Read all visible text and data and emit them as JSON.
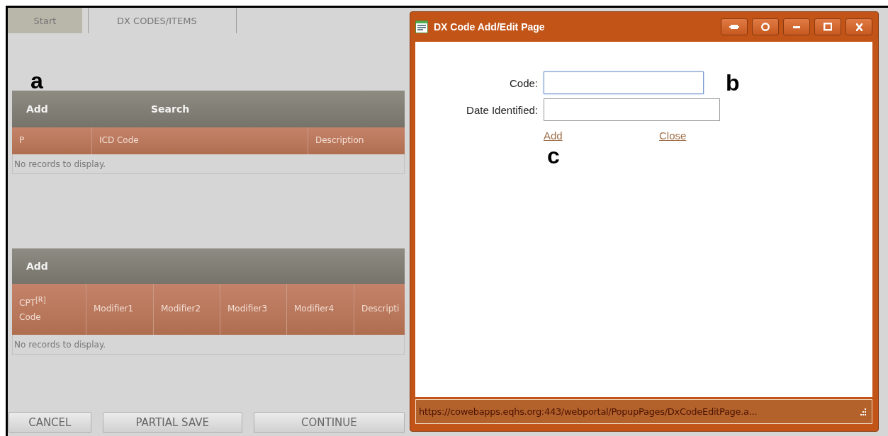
{
  "tabs": [
    {
      "label": "Start",
      "selected": false
    },
    {
      "label": "DX CODES/ITEMS",
      "selected": true
    }
  ],
  "dx_grid": {
    "toolbar": [
      "Add",
      "Search"
    ],
    "columns": [
      "P",
      "ICD Code",
      "Description"
    ],
    "empty_text": "No records to display."
  },
  "cpt_grid": {
    "toolbar": [
      "Add"
    ],
    "columns": [
      "CPT$^{[R]}$ Code",
      "Modifier1",
      "Modifier2",
      "Modifier3",
      "Modifier4",
      "Descripti"
    ],
    "empty_text": "No records to display."
  },
  "buttons": [
    "CANCEL",
    "PARTIAL SAVE",
    "CONTINUE"
  ],
  "annotations": [
    "a",
    "b",
    "c"
  ],
  "popup": {
    "title": "DX Code Add/Edit Page",
    "fields": [
      {
        "label": "Code:",
        "focused": true
      },
      {
        "label": "Date Identified:",
        "focused": false
      }
    ],
    "links": [
      "Add",
      "Close"
    ],
    "status_bar": "https://cowebapps.eqhs.org:443/webportal/PopupPages/DxCodeEditPage.a..."
  }
}
